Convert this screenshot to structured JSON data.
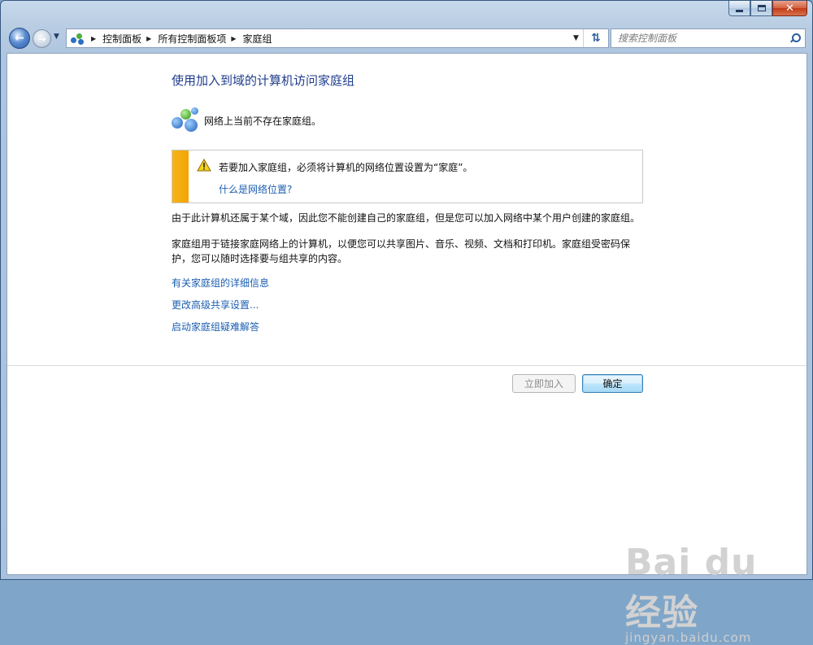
{
  "window": {
    "close_glyph": "✕"
  },
  "navbar": {
    "breadcrumbs": [
      "控制面板",
      "所有控制面板项",
      "家庭组"
    ],
    "search_placeholder": "搜索控制面板"
  },
  "content": {
    "title": "使用加入到域的计算机访问家庭组",
    "status": "网络上当前不存在家庭组。",
    "notice": {
      "text": "若要加入家庭组，必须将计算机的网络位置设置为“家庭”。",
      "link": "什么是网络位置?"
    },
    "para1": "由于此计算机还属于某个域，因此您不能创建自己的家庭组，但是您可以加入网络中某个用户创建的家庭组。",
    "para2": "家庭组用于链接家庭网络上的计算机，以便您可以共享图片、音乐、视频、文档和打印机。家庭组受密码保护，您可以随时选择要与组共享的内容。",
    "links": [
      "有关家庭组的详细信息",
      "更改高级共享设置...",
      "启动家庭组疑难解答"
    ]
  },
  "buttons": {
    "join": "立即加入",
    "ok": "确定"
  },
  "watermark": {
    "main": "Bai du 经验",
    "sub": "jingyan.baidu.com"
  },
  "colors": {
    "link": "#1c5fb0",
    "title": "#1e3c8c",
    "notice_bar": "#f6b417"
  }
}
